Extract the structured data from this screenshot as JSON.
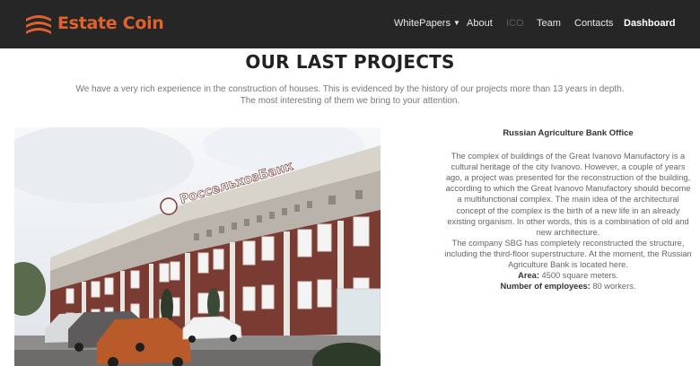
{
  "brand": {
    "name": "Estate Coin",
    "accent": "#e2622e",
    "header_bg": "#262626"
  },
  "nav": {
    "items": [
      {
        "label": "WhitePapers",
        "dropdown": true
      },
      {
        "label": "About"
      },
      {
        "label": "ICO",
        "muted": true
      },
      {
        "label": "Team"
      },
      {
        "label": "Contacts"
      },
      {
        "label": "Dashboard",
        "bold": true
      }
    ]
  },
  "section": {
    "title": "OUR LAST PROJECTS",
    "intro_line1": "We have a very rich experience in the construction of houses. This is evidenced by the history of our projects more than 13 years in depth.",
    "intro_line2": "The most interesting of them we bring to your attention."
  },
  "project": {
    "title": "Russian Agriculture Bank Office",
    "photo_sign": "РоссельхозБанк",
    "description": "The complex of buildings of the Great Ivanovo Manufactory is a cultural heritage of the city Ivanovo. However, a couple of years ago, a project was presented for the reconstruction of the building, according to which the Great Ivanovo Manufactory should become a multifunctional complex. The main idea of the architectural concept of the complex is the birth of a new life in an already existing organism. In other words, this is a combination of old and new architecture.",
    "description2": "The company SBG has completely reconstructed the structure, including the third-floor superstructure. At the moment, the Russian Agriculture Bank is located here.",
    "area_label": "Area:",
    "area_value": "4500 square meters.",
    "employees_label": "Number of employees:",
    "employees_value": "80 workers."
  }
}
